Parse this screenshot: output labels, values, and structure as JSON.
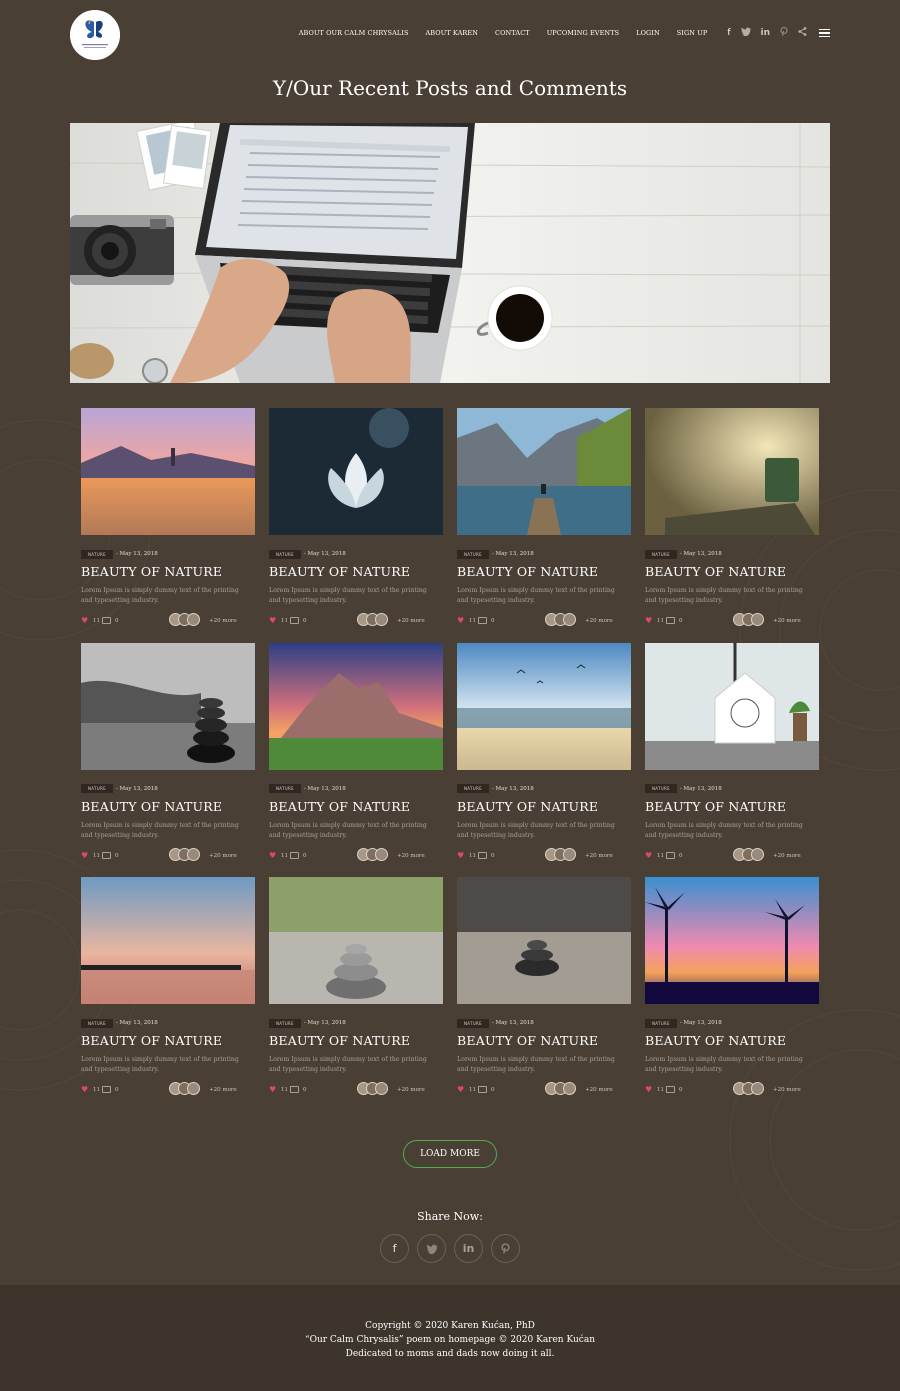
{
  "header": {
    "nav": [
      "ABOUT OUR CALM CHRYSALIS",
      "ABOUT KAREN",
      "CONTACT",
      "UPCOMING EVENTS",
      "LOGIN",
      "SIGN UP"
    ],
    "social_icons": [
      "facebook-icon",
      "twitter-icon",
      "linkedin-icon",
      "pinterest-icon",
      "share-icon",
      "menu-icon"
    ]
  },
  "page_title": "Y/Our Recent Posts and Comments",
  "posts": [
    {
      "category": "NATURE",
      "date": "- May 13, 2018",
      "title": "BEAUTY OF NATURE",
      "excerpt": "Lorem Ipsum is simply dummy text of the printing and typesetting industry.",
      "likes": "11",
      "comments": "0",
      "more": "+20 more",
      "image": "lake-sunset"
    },
    {
      "category": "NATURE",
      "date": "- May 13, 2018",
      "title": "BEAUTY OF NATURE",
      "excerpt": "Lorem Ipsum is simply dummy text of the printing and typesetting industry.",
      "likes": "11",
      "comments": "0",
      "more": "+20 more",
      "image": "lotus"
    },
    {
      "category": "NATURE",
      "date": "- May 13, 2018",
      "title": "BEAUTY OF NATURE",
      "excerpt": "Lorem Ipsum is simply dummy text of the printing and typesetting industry.",
      "likes": "11",
      "comments": "0",
      "more": "+20 more",
      "image": "fjord-dock"
    },
    {
      "category": "NATURE",
      "date": "- May 13, 2018",
      "title": "BEAUTY OF NATURE",
      "excerpt": "Lorem Ipsum is simply dummy text of the printing and typesetting industry.",
      "likes": "11",
      "comments": "0",
      "more": "+20 more",
      "image": "tea-book"
    },
    {
      "category": "NATURE",
      "date": "- May 13, 2018",
      "title": "BEAUTY OF NATURE",
      "excerpt": "Lorem Ipsum is simply dummy text of the printing and typesetting industry.",
      "likes": "11",
      "comments": "0",
      "more": "+20 more",
      "image": "stone-stack-beach"
    },
    {
      "category": "NATURE",
      "date": "- May 13, 2018",
      "title": "BEAUTY OF NATURE",
      "excerpt": "Lorem Ipsum is simply dummy text of the printing and typesetting industry.",
      "likes": "11",
      "comments": "0",
      "more": "+20 more",
      "image": "mountain-sunset"
    },
    {
      "category": "NATURE",
      "date": "- May 13, 2018",
      "title": "BEAUTY OF NATURE",
      "excerpt": "Lorem Ipsum is simply dummy text of the printing and typesetting industry.",
      "likes": "11",
      "comments": "0",
      "more": "+20 more",
      "image": "sea-birds"
    },
    {
      "category": "NATURE",
      "date": "- May 13, 2018",
      "title": "BEAUTY OF NATURE",
      "excerpt": "Lorem Ipsum is simply dummy text of the printing and typesetting industry.",
      "likes": "11",
      "comments": "0",
      "more": "+20 more",
      "image": "clock-window"
    },
    {
      "category": "NATURE",
      "date": "- May 13, 2018",
      "title": "BEAUTY OF NATURE",
      "excerpt": "Lorem Ipsum is simply dummy text of the printing and typesetting industry.",
      "likes": "11",
      "comments": "0",
      "more": "+20 more",
      "image": "pier-sunset"
    },
    {
      "category": "NATURE",
      "date": "- May 13, 2018",
      "title": "BEAUTY OF NATURE",
      "excerpt": "Lorem Ipsum is simply dummy text of the printing and typesetting industry.",
      "likes": "11",
      "comments": "0",
      "more": "+20 more",
      "image": "pebble-cairn"
    },
    {
      "category": "NATURE",
      "date": "- May 13, 2018",
      "title": "BEAUTY OF NATURE",
      "excerpt": "Lorem Ipsum is simply dummy text of the printing and typesetting industry.",
      "likes": "11",
      "comments": "0",
      "more": "+20 more",
      "image": "rock-cairn"
    },
    {
      "category": "NATURE",
      "date": "- May 13, 2018",
      "title": "BEAUTY OF NATURE",
      "excerpt": "Lorem Ipsum is simply dummy text of the printing and typesetting industry.",
      "likes": "11",
      "comments": "0",
      "more": "+20 more",
      "image": "palm-sunset"
    }
  ],
  "load_more": "LOAD MORE",
  "share": {
    "label": "Share Now:",
    "buttons": [
      "facebook-icon",
      "twitter-icon",
      "linkedin-icon",
      "pinterest-icon"
    ]
  },
  "footer": {
    "line1": "Copyright © 2020 Karen Kućan, PhD",
    "line2": "“Our Calm Chrysalis” poem on homepage © 2020 Karen Kućan",
    "line3": "Dedicated to moms and dads now doing it all."
  },
  "colors": {
    "background": "#4a3f34",
    "footer_bg": "#3d342b",
    "load_more_border": "#4caf50",
    "heart": "#e0457a"
  }
}
